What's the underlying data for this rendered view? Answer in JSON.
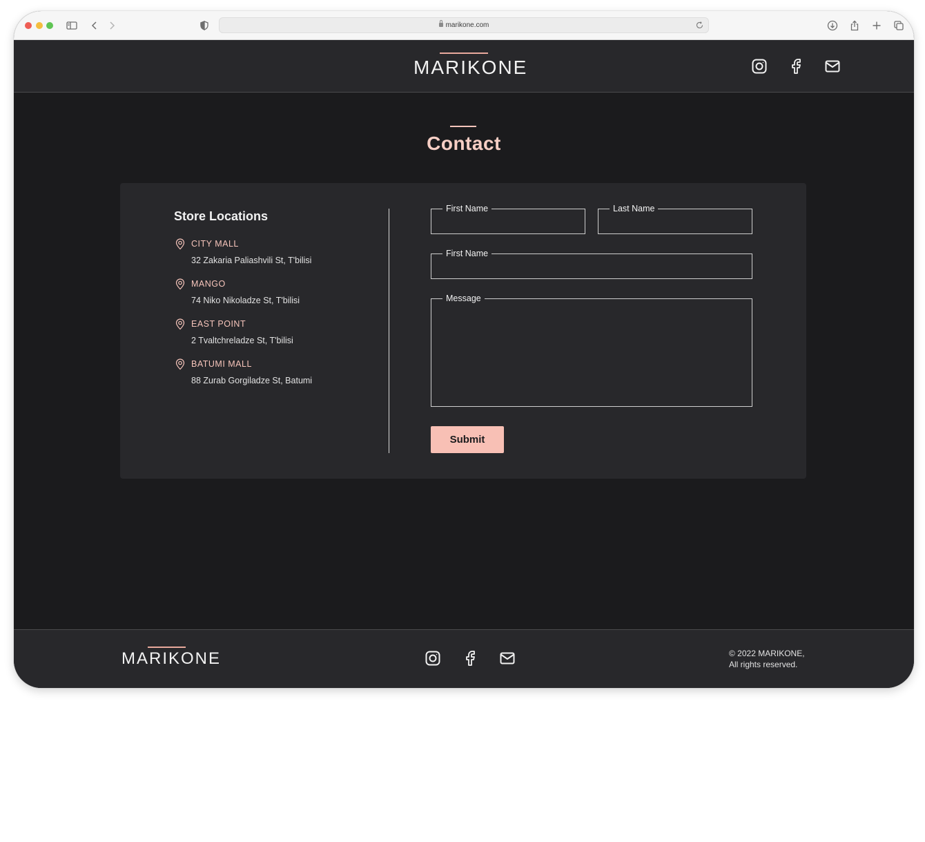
{
  "browser": {
    "url": "marikone.com"
  },
  "header": {
    "logo": "MARIKONE",
    "social": [
      {
        "icon": "instagram-icon"
      },
      {
        "icon": "facebook-icon"
      },
      {
        "icon": "mail-icon"
      }
    ]
  },
  "main": {
    "title": "Contact",
    "stores": {
      "title": "Store Locations",
      "items": [
        {
          "name": "CITY MALL",
          "address": "32 Zakaria Paliashvili St, T'bilisi"
        },
        {
          "name": "MANGO",
          "address": "74 Niko Nikoladze St, T'bilisi"
        },
        {
          "name": "EAST POINT",
          "address": "2 Tvaltchreladze St, T'bilisi"
        },
        {
          "name": "BATUMI MALL",
          "address": "88 Zurab Gorgiladze St, Batumi"
        }
      ]
    },
    "form": {
      "first_name_label": "First Name",
      "last_name_label": "Last Name",
      "email_label": "First Name",
      "message_label": "Message",
      "submit_label": "Submit"
    }
  },
  "footer": {
    "logo": "MARIKONE",
    "copyright_line1": "© 2022 MARIKONE,",
    "copyright_line2": "All rights reserved."
  },
  "colors": {
    "accent": "#f8c0b5",
    "page_bg": "#1b1b1d",
    "panel_bg": "#28282b"
  }
}
